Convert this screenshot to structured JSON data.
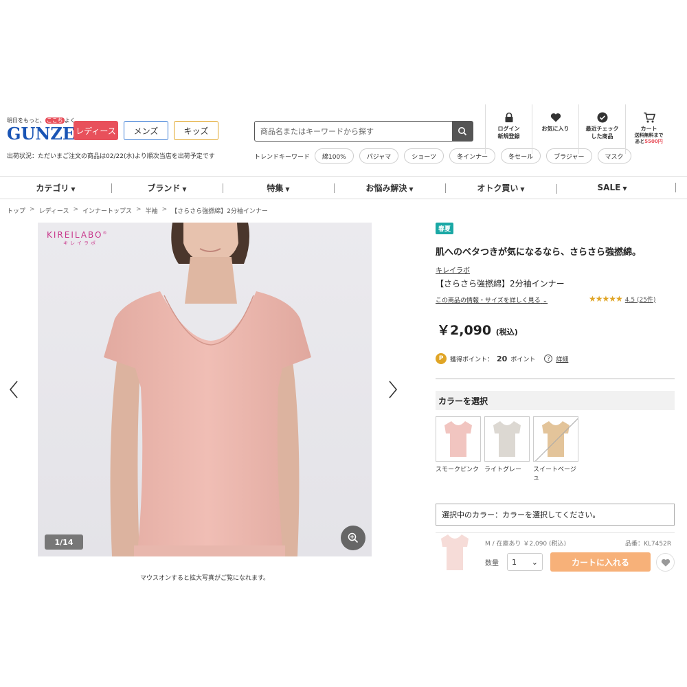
{
  "header": {
    "tagline_pre": "明日をもっと、",
    "tagline_hl": "ここち",
    "tagline_post": "よく",
    "logo": "GUNZE",
    "genders": [
      "レディース",
      "メンズ",
      "キッズ"
    ],
    "ship_status": "出荷状況：ただいまご注文の商品は02/22(水)より順次当店を出荷予定です",
    "search_placeholder": "商品名またはキーワードから探す",
    "trend_label": "トレンドキーワード",
    "trend_keywords": [
      "綿100%",
      "パジャマ",
      "ショーツ",
      "冬インナー",
      "冬セール",
      "ブラジャー",
      "マスク"
    ],
    "icons": {
      "login": "ログイン\n新規登録",
      "favorites": "お気に入り",
      "recent": "最近チェック\nした商品",
      "cart": "カート",
      "cart_sub1": "送料無料まで",
      "cart_sub2_pre": "あと",
      "cart_sub2_amt": "5500円"
    }
  },
  "nav": [
    "カテゴリ",
    "ブランド",
    "特集",
    "お悩み解決",
    "オトク買い",
    "SALE"
  ],
  "breadcrumb": [
    "トップ",
    "レディース",
    "インナートップス",
    "半袖",
    "【さらさら強撚綿】2分袖インナー"
  ],
  "gallery": {
    "brand": "KIREILABO",
    "brand_mark": "®",
    "brand_sub": "キレイラボ",
    "counter": "1/14",
    "hover_note": "マウスオンすると拡大写真がご覧になれます。"
  },
  "product": {
    "season_badge": "春夏",
    "catch": "肌へのベタつきが気になるなら、さらさら強撚綿。",
    "brand_link": "キレイラボ",
    "name": "【さらさら強撚綿】2分袖インナー",
    "info_link": "この商品の情報・サイズを詳しく見る",
    "stars": "★★★★★",
    "rating": "4.5 (25件)",
    "rating_value": 4.5,
    "price": "￥2,090",
    "tax": "(税込)",
    "points_label": "獲得ポイント：",
    "points_value": "20",
    "points_unit": "ポイント",
    "points_detail": "詳細",
    "color_heading": "カラーを選択",
    "colors": [
      {
        "name": "スモークピンク",
        "hex": "#f1c5c0"
      },
      {
        "name": "ライトグレー",
        "hex": "#dcd8d2"
      },
      {
        "name": "スイートベージュ",
        "hex": "#e3c49a"
      }
    ],
    "selected_color_text": "選択中のカラー：カラーを選択してください。",
    "sku_info": "M / 在庫あり ￥2,090 (税込)",
    "sku_no": "品番：KL7452R",
    "qty_label": "数量",
    "qty_value": "1",
    "cart_button": "カートに入れる"
  },
  "colors": {
    "ladies": "#e8505b",
    "accent_orange": "#f7b179",
    "logo_blue": "#1a55b5",
    "season_teal": "#1aa8a5",
    "star": "#e0a526"
  }
}
